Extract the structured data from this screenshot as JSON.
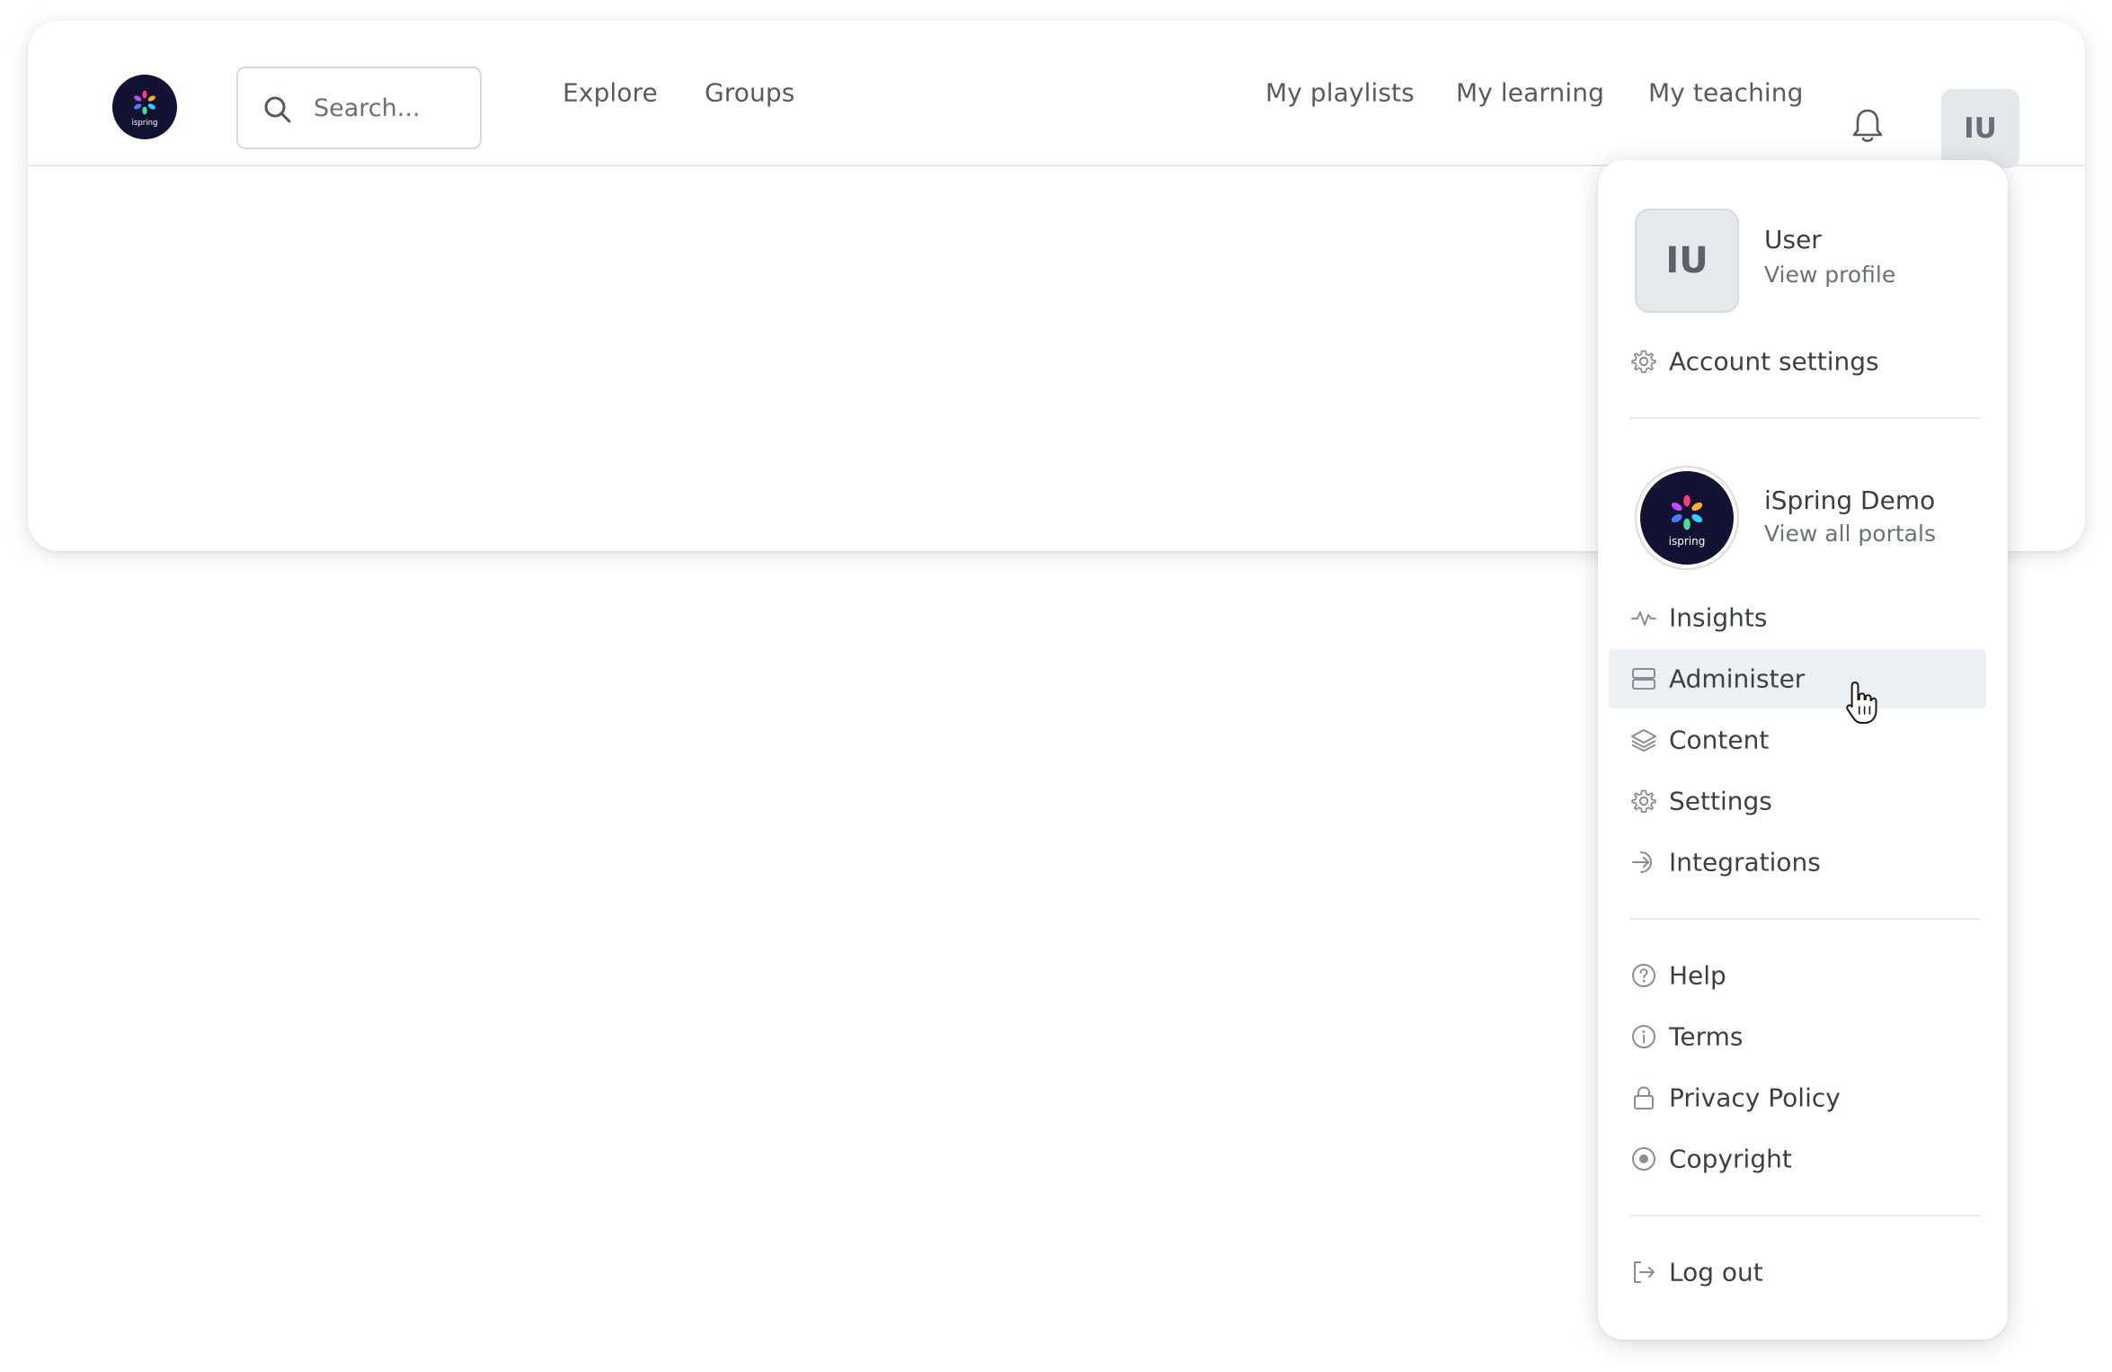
{
  "search": {
    "placeholder": "Search..."
  },
  "nav": {
    "explore": "Explore",
    "groups": "Groups",
    "my_playlists": "My playlists",
    "my_learning": "My learning",
    "my_teaching": "My teaching"
  },
  "user": {
    "initials": "IU",
    "name": "User",
    "view_profile": "View profile"
  },
  "menu": {
    "account_settings": "Account settings",
    "portal": {
      "name": "iSpring Demo",
      "view_all": "View all portals",
      "logo_text": "ispring"
    },
    "admin_items": [
      {
        "label": "Insights",
        "icon": "activity-icon"
      },
      {
        "label": "Administer",
        "icon": "server-icon"
      },
      {
        "label": "Content",
        "icon": "layers-icon"
      },
      {
        "label": "Settings",
        "icon": "gear-icon"
      },
      {
        "label": "Integrations",
        "icon": "login-arrow-icon"
      }
    ],
    "info_items": [
      {
        "label": "Help",
        "icon": "help-circle-icon"
      },
      {
        "label": "Terms",
        "icon": "info-circle-icon"
      },
      {
        "label": "Privacy Policy",
        "icon": "lock-icon"
      },
      {
        "label": "Copyright",
        "icon": "copyright-icon"
      }
    ],
    "log_out": "Log out",
    "highlighted_item": "Administer"
  },
  "colors": {
    "logo_bg": "#141233",
    "highlight_bg": "#edf0f2",
    "text": "#3d3f42",
    "muted": "#6d7074"
  }
}
